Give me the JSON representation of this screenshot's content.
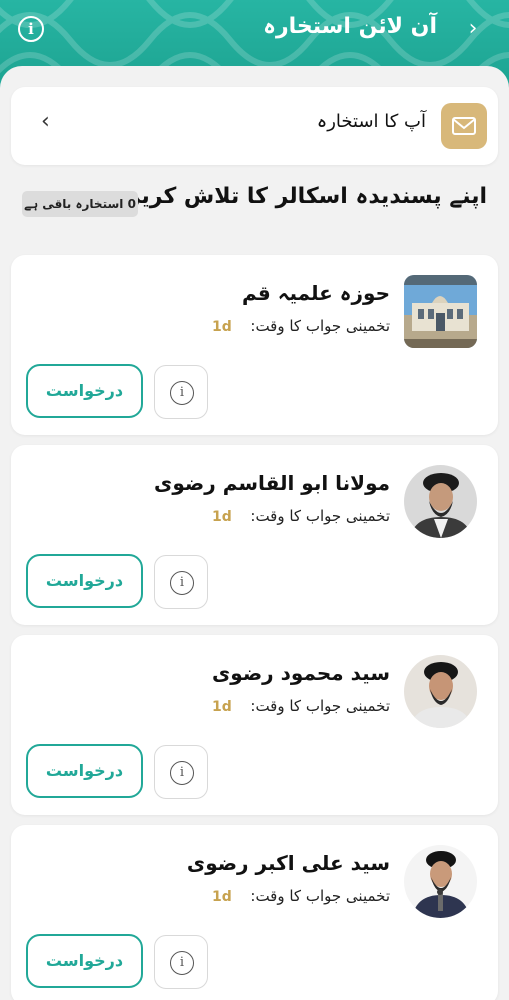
{
  "header": {
    "title": "آن لائن استخارہ",
    "back_icon": "chevron-right-icon",
    "info_icon": "info-icon",
    "info_glyph": "i"
  },
  "inbox": {
    "label": "آپ کا استخارہ",
    "icon": "mail-icon",
    "chevron_icon": "chevron-left-icon"
  },
  "search": {
    "title": "اپنے پسندیدہ اسکالر کا تلاش کریں",
    "remaining": "0 استخارہ باقی ہے"
  },
  "scholars": [
    {
      "name": "حوزہ علمیہ قم",
      "eta_label": "تخمینی جواب کا وقت:",
      "eta_value": "1d",
      "request_label": "درخواست",
      "info_glyph": "i"
    },
    {
      "name": "مولانا ابو القاسم رضوی",
      "eta_label": "تخمینی جواب کا وقت:",
      "eta_value": "1d",
      "request_label": "درخواست",
      "info_glyph": "i"
    },
    {
      "name": "سید محمود رضوی",
      "eta_label": "تخمینی جواب کا وقت:",
      "eta_value": "1d",
      "request_label": "درخواست",
      "info_glyph": "i"
    },
    {
      "name": "سید علی اکبر رضوی",
      "eta_label": "تخمینی جواب کا وقت:",
      "eta_value": "1d",
      "request_label": "درخواست",
      "info_glyph": "i"
    }
  ],
  "colors": {
    "brand": "#1fa99a",
    "accent_gold": "#d8b87a",
    "eta_gold": "#c7a24f",
    "background": "#f2f2f2"
  }
}
